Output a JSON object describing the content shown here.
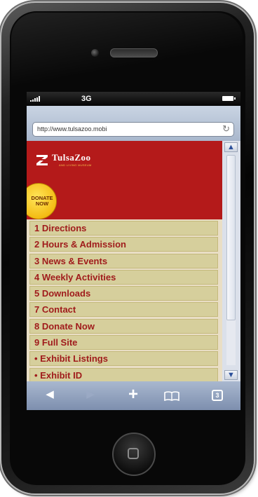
{
  "statusbar": {
    "carrier": "3G"
  },
  "browser": {
    "url": "http://www.tulsazoo.mobi"
  },
  "site": {
    "logo_name": "TulsaZoo",
    "logo_tagline": "AND LIVING MUSEUM",
    "donate_badge": [
      "DONATE",
      "NOW"
    ]
  },
  "menu": [
    {
      "label": "1 Directions"
    },
    {
      "label": "2 Hours & Admission"
    },
    {
      "label": "3 News & Events"
    },
    {
      "label": "4 Weekly Activities"
    },
    {
      "label": "5 Downloads"
    },
    {
      "label": "7 Contact"
    },
    {
      "label": "8 Donate Now"
    },
    {
      "label": "9 Full Site"
    },
    {
      "label": "• Exhibit Listings"
    },
    {
      "label": "• Exhibit ID"
    }
  ],
  "toolbar": {
    "pages_count": "3"
  },
  "colors": {
    "banner": "#b41a1a",
    "menu_bg": "#d6cf9c",
    "menu_text": "#a01c1c",
    "donate": "#f4bc14"
  }
}
